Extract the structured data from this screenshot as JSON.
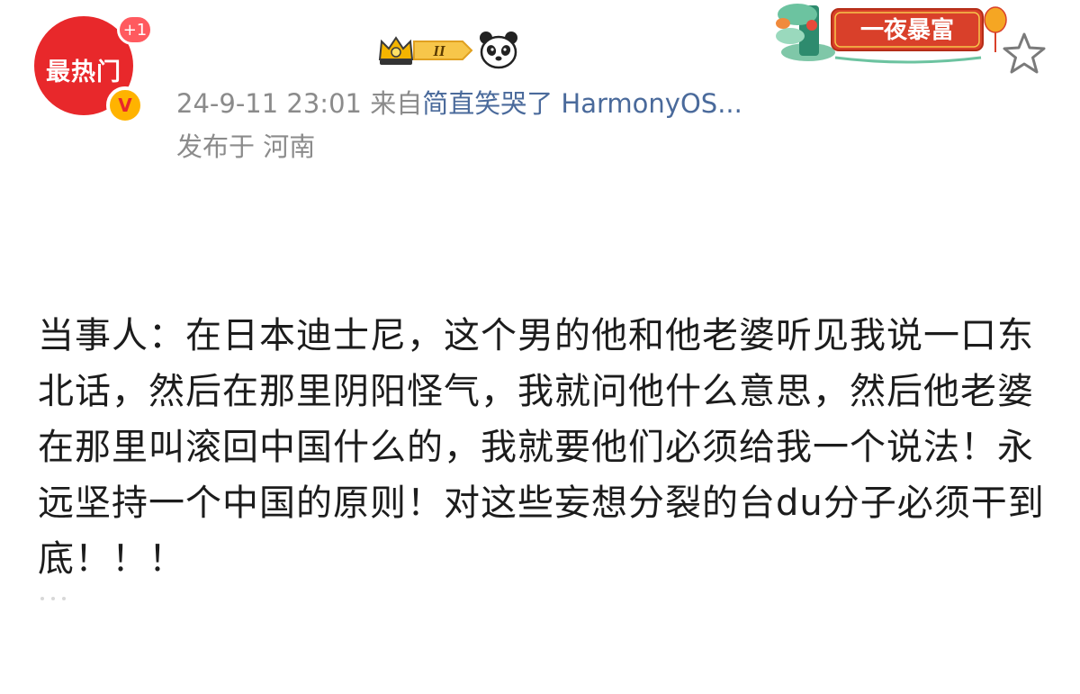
{
  "avatar": {
    "text": "最热门",
    "badge": "+1",
    "verified_mark": "V",
    "bg_color": "#e8282b"
  },
  "badges": {
    "level_badge": "II",
    "level_icon": "crown-icon",
    "panda_icon": "panda-icon"
  },
  "meta": {
    "time": "24-9-11 23:01",
    "from_prefix": "来自",
    "source": "简直笑哭了 HarmonyOS...",
    "location": "发布于 河南"
  },
  "decoration": {
    "banner_text": "一夜暴富"
  },
  "actions": {
    "favorite_icon": "star-icon"
  },
  "post": {
    "text": "当事人：在日本迪士尼，这个男的他和他老婆听见我说一口东北话，然后在那里阴阳怪气，我就问他什么意思，然后他老婆在那里叫滚回中国什么的，我就要他们必须给我一个说法！永远坚持一个中国的原则！对这些妄想分裂的台du分子必须干到底！！！"
  },
  "colors": {
    "meta_gray": "#8b8b8b",
    "link_blue": "#4a6a9b",
    "text": "#1c1c1c"
  }
}
